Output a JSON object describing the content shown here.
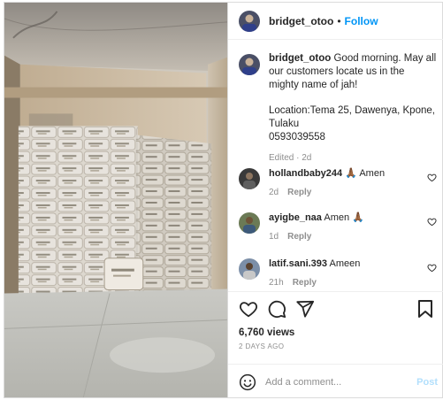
{
  "post": {
    "username": "bridget_otoo",
    "separator": "•",
    "follow_label": "Follow",
    "caption_text": "Good morning. May all our customers locate us in the mighty name of jah!",
    "location_text": "Location:Tema 25, Dawenya, Kpone, Tulaku\n0593039558",
    "caption_meta": "Edited · 2d"
  },
  "comments": [
    {
      "user": "hollandbaby244",
      "text": "🙏🏾 Amen",
      "time": "2d",
      "reply_label": "Reply"
    },
    {
      "user": "ayigbe_naa",
      "text": "Amen 🙏🏾",
      "time": "1d",
      "reply_label": "Reply"
    },
    {
      "user": "latif.sani.393",
      "text": "Ameen",
      "time": "21h",
      "reply_label": "Reply"
    }
  ],
  "stats": {
    "views": "6,760 views",
    "posted": "2 DAYS AGO"
  },
  "composer": {
    "placeholder": "Add a comment...",
    "post_label": "Post"
  },
  "icons": {
    "like": "heart-icon",
    "comment": "comment-icon",
    "share": "share-icon",
    "save": "bookmark-icon",
    "emoji": "emoji-icon",
    "comment_like": "heart-icon"
  },
  "colors": {
    "accent": "#0095f6",
    "post_disabled": "#b2dffc",
    "muted": "#8e8e8e",
    "text": "#262626"
  }
}
